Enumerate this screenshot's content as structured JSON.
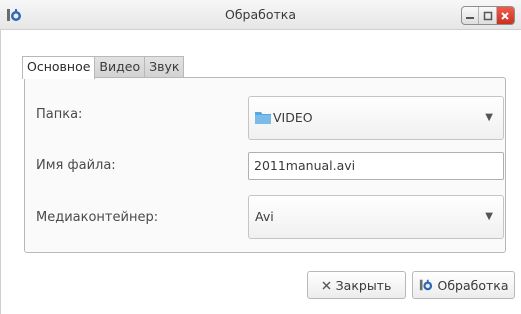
{
  "window": {
    "title": "Обработка",
    "icon": "app-process-icon",
    "controls": [
      "minimize-icon",
      "maximize-icon",
      "close-icon"
    ]
  },
  "tabs": [
    {
      "label": "Основное",
      "active": true
    },
    {
      "label": "Видео",
      "active": false
    },
    {
      "label": "Звук",
      "active": false
    }
  ],
  "form": {
    "folder": {
      "label": "Папка:",
      "value": "VIDEO",
      "icon": "folder-icon"
    },
    "filename": {
      "label": "Имя файла:",
      "value": "2011manual.avi"
    },
    "container": {
      "label": "Медиаконтейнер:",
      "value": "Avi"
    }
  },
  "buttons": {
    "close": {
      "label": "Закрыть",
      "icon": "close-x-icon"
    },
    "process": {
      "label": "Обработка",
      "icon": "app-process-icon"
    }
  },
  "colors": {
    "close_button": "#d8412f",
    "folder": "#5aa7e0"
  }
}
